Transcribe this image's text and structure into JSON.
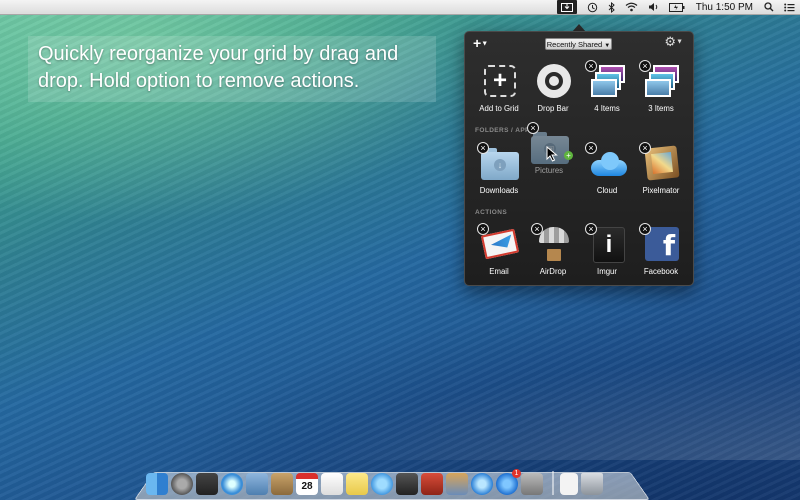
{
  "menubar": {
    "clock": "Thu 1:50 PM",
    "status_icons": [
      "dropzone-icon",
      "time-machine-icon",
      "bluetooth-icon",
      "wifi-icon",
      "volume-icon",
      "battery-icon"
    ],
    "search_icon": "spotlight-icon",
    "list_icon": "notification-center-icon"
  },
  "caption": {
    "text": "Quickly reorganize your grid by drag and drop. Hold option to remove actions."
  },
  "popover": {
    "add_menu": "+",
    "dropdown_value": "Recently Shared",
    "gear_menu": "⚙",
    "sections": [
      {
        "label": "",
        "tiles": [
          {
            "label": "Add to Grid",
            "icon": "add-icon",
            "closable": false
          },
          {
            "label": "Drop Bar",
            "icon": "drop-bar-icon",
            "closable": false
          },
          {
            "label": "4 Items",
            "icon": "photo-stack-icon",
            "closable": true
          },
          {
            "label": "3 Items",
            "icon": "photo-stack-icon",
            "closable": true
          }
        ]
      },
      {
        "label": "FOLDERS / APP",
        "tiles": [
          {
            "label": "Downloads",
            "icon": "downloads-folder-icon",
            "closable": true
          },
          {
            "label": "Pictures",
            "icon": "pictures-folder-icon",
            "closable": true,
            "dragging": true
          },
          {
            "label": "Cloud",
            "icon": "cloud-icon",
            "closable": true
          },
          {
            "label": "Pixelmator",
            "icon": "pixelmator-icon",
            "closable": true
          }
        ]
      },
      {
        "label": "ACTIONS",
        "tiles": [
          {
            "label": "Email",
            "icon": "email-icon",
            "closable": true
          },
          {
            "label": "AirDrop",
            "icon": "airdrop-icon",
            "closable": true
          },
          {
            "label": "Imgur",
            "icon": "imgur-icon",
            "closable": true
          },
          {
            "label": "Facebook",
            "icon": "facebook-icon",
            "closable": true
          }
        ]
      }
    ]
  },
  "dock": {
    "date_badge": "28",
    "app_store_badge": "1",
    "apps": [
      "finder-icon",
      "launchpad-icon",
      "mission-control-icon",
      "safari-icon",
      "mail-icon",
      "contacts-icon",
      "calendar-icon",
      "reminders-icon",
      "notes-icon",
      "messages-icon",
      "facetime-icon",
      "photo-booth-icon",
      "iphoto-icon",
      "itunes-icon",
      "app-store-icon",
      "system-preferences-icon"
    ],
    "right": [
      "document-icon",
      "trash-icon"
    ]
  }
}
